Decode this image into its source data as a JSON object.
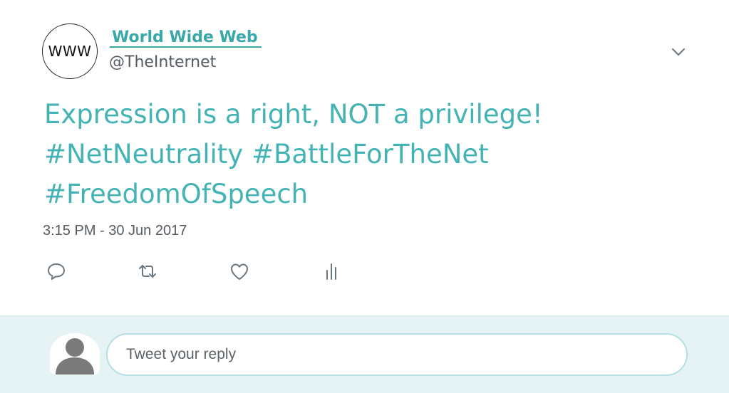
{
  "user": {
    "avatar_text": "WWW",
    "display_name": "World Wide Web",
    "handle": "@TheInternet"
  },
  "tweet": {
    "lines": [
      "Expression is a right, NOT a privilege!",
      "#NetNeutrality #BattleForTheNet",
      "#FreedomOfSpeech"
    ],
    "timestamp": "3:15 PM - 30 Jun 2017"
  },
  "actions": [
    {
      "name": "reply-icon"
    },
    {
      "name": "retweet-icon"
    },
    {
      "name": "like-icon"
    },
    {
      "name": "analytics-icon"
    }
  ],
  "reply": {
    "placeholder": "Tweet your reply"
  },
  "colors": {
    "accent": "#45b3b3",
    "link": "#3aa8a8",
    "secondary_text": "#555b60",
    "reply_background": "#e5f3f4",
    "icon_gray": "#6b7780"
  }
}
